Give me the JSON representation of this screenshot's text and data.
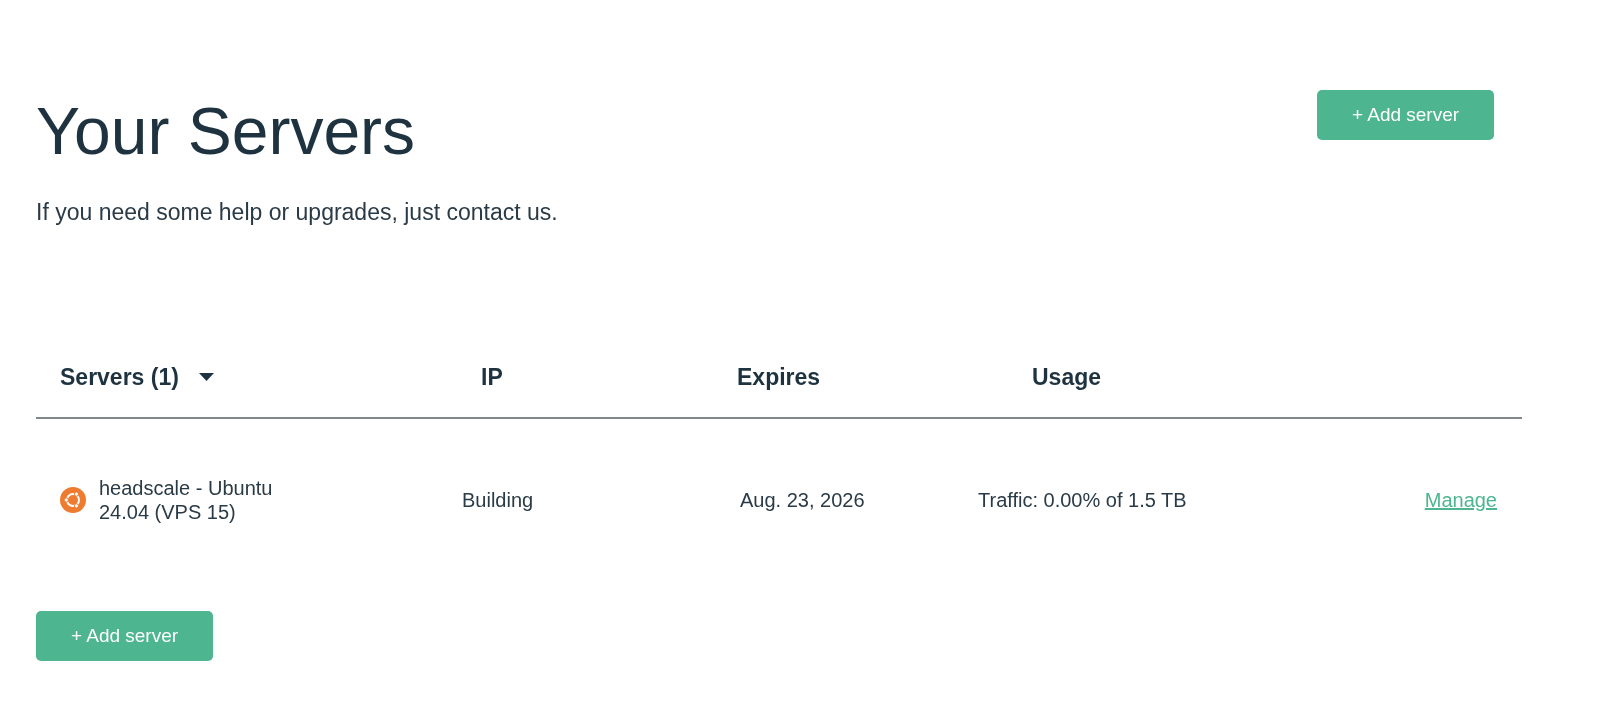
{
  "page": {
    "title": "Your Servers",
    "subtitle": "If you need some help or upgrades, just contact us.",
    "add_button": "+ Add server"
  },
  "table": {
    "columns": [
      {
        "label": "Servers (1)",
        "dropdown": true
      },
      {
        "label": "IP",
        "dropdown": false
      },
      {
        "label": "Expires",
        "dropdown": false
      },
      {
        "label": "Usage",
        "dropdown": false
      }
    ],
    "rows": [
      {
        "name": "headscale - Ubuntu 24.04 (VPS 15)",
        "ip": "Building",
        "expires": "Aug. 23, 2026",
        "usage": "Traffic: 0.00% of 1.5 TB",
        "action": "Manage"
      }
    ]
  },
  "footer": {
    "add_button": "+ Add server"
  }
}
